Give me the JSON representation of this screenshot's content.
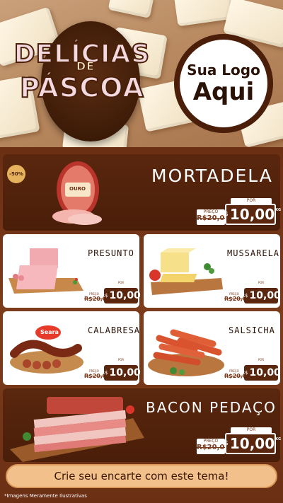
{
  "hero": {
    "title_line1": "DELÍCIAS",
    "title_line2": "DE",
    "title_line3": "PÁSCOA",
    "logo_line1": "Sua Logo",
    "logo_line2": "Aqui"
  },
  "featured": {
    "name": "MORTADELA",
    "badge": "-50%",
    "brand": "OURO",
    "price_label": "PREÇO",
    "old_price": "R$20,00",
    "por_label": "POR",
    "currency": "R$",
    "new_price": "10,00",
    "unit": "KG"
  },
  "cards": [
    {
      "name": "PRESUNTO",
      "price_label": "PREÇO",
      "old_price": "R$20,00",
      "por_label": "POR",
      "currency": "R$",
      "new_price": "10,00"
    },
    {
      "name": "MUSSARELA",
      "price_label": "PREÇO",
      "old_price": "R$20,00",
      "por_label": "POR",
      "currency": "R$",
      "new_price": "10,00"
    },
    {
      "name": "CALABRESA",
      "brand": "Seara",
      "price_label": "PREÇO",
      "old_price": "R$20,00",
      "por_label": "POR",
      "currency": "R$",
      "new_price": "10,00"
    },
    {
      "name": "SALSICHA",
      "price_label": "PREÇO",
      "old_price": "R$20,00",
      "por_label": "POR",
      "currency": "R$",
      "new_price": "10,00"
    }
  ],
  "bacon": {
    "name": "BACON PEDAÇO",
    "price_label": "PREÇO",
    "old_price": "R$20,00",
    "por_label": "POR",
    "currency": "R$",
    "new_price": "10,00",
    "unit": "KG"
  },
  "cta": "Crie seu encarte com este tema!",
  "footnote": "*Imagens Meramente Ilustrativas",
  "colors": {
    "brown_dark": "#4a1e09",
    "brown": "#7a3a1c",
    "cream": "#f2c08a",
    "pink_title": "#f3d9e0"
  }
}
